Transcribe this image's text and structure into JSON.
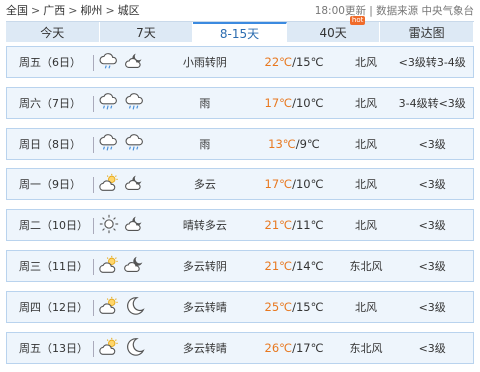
{
  "breadcrumb": [
    "全国",
    "广西",
    "柳州",
    "城区"
  ],
  "update_info": "18:00更新 | 数据来源 中央气象台",
  "tabs": [
    {
      "label": "今天",
      "active": false,
      "hot": false
    },
    {
      "label": "7天",
      "active": false,
      "hot": false
    },
    {
      "label": "8-15天",
      "active": true,
      "hot": false
    },
    {
      "label": "40天",
      "active": false,
      "hot": true,
      "badge": "hot"
    },
    {
      "label": "雷达图",
      "active": false,
      "hot": false
    }
  ],
  "forecast": [
    {
      "date": "周五（6日）",
      "icons": [
        "light-rain-icon",
        "partly-cloudy-night-icon"
      ],
      "desc": "小雨转阴",
      "high": "22℃",
      "low": "15℃",
      "wind": "北风",
      "level": "<3级转3-4级"
    },
    {
      "date": "周六（7日）",
      "icons": [
        "rain-icon",
        "rain-icon"
      ],
      "desc": "雨",
      "high": "17℃",
      "low": "10℃",
      "wind": "北风",
      "level": "3-4级转<3级"
    },
    {
      "date": "周日（8日）",
      "icons": [
        "rain-icon",
        "rain-icon"
      ],
      "desc": "雨",
      "high": "13℃",
      "low": "9℃",
      "wind": "北风",
      "level": "<3级"
    },
    {
      "date": "周一（9日）",
      "icons": [
        "partly-cloudy-day-icon",
        "partly-cloudy-night-icon"
      ],
      "desc": "多云",
      "high": "17℃",
      "low": "10℃",
      "wind": "北风",
      "level": "<3级"
    },
    {
      "date": "周二（10日）",
      "icons": [
        "sunny-icon",
        "partly-cloudy-night-icon"
      ],
      "desc": "晴转多云",
      "high": "21℃",
      "low": "11℃",
      "wind": "北风",
      "level": "<3级"
    },
    {
      "date": "周三（11日）",
      "icons": [
        "partly-cloudy-day-icon",
        "overcast-night-icon"
      ],
      "desc": "多云转阴",
      "high": "21℃",
      "low": "14℃",
      "wind": "东北风",
      "level": "<3级"
    },
    {
      "date": "周四（12日）",
      "icons": [
        "partly-cloudy-day-icon",
        "moon-icon"
      ],
      "desc": "多云转晴",
      "high": "25℃",
      "low": "15℃",
      "wind": "北风",
      "level": "<3级"
    },
    {
      "date": "周五（13日）",
      "icons": [
        "partly-cloudy-day-icon",
        "moon-icon"
      ],
      "desc": "多云转晴",
      "high": "26℃",
      "low": "17℃",
      "wind": "东北风",
      "level": "<3级"
    }
  ],
  "colors": {
    "high_temp": "#e8781f",
    "row_bg": "#eef5fc",
    "row_border": "#b9d3ee",
    "tab_active": "#2b6cb0"
  }
}
